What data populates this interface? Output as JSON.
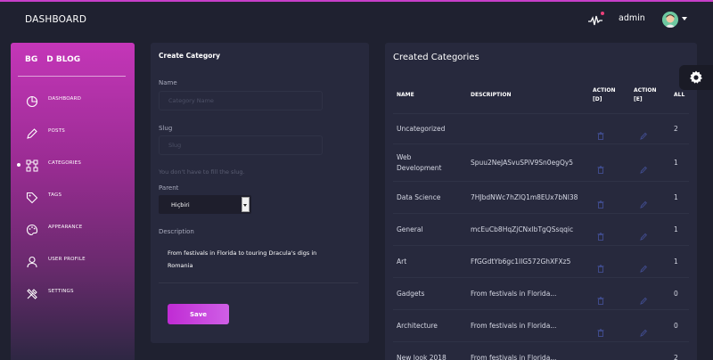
{
  "header": {
    "title": "DASHBOARD",
    "user_name": "admin"
  },
  "sidebar": {
    "brand_left": "BG",
    "brand_right": "D BLOG",
    "items": [
      {
        "label": "DASHBOARD",
        "icon": "dashboard-icon"
      },
      {
        "label": "POSTS",
        "icon": "pencil-icon"
      },
      {
        "label": "CATEGORIES",
        "icon": "hierarchy-icon",
        "active": true
      },
      {
        "label": "TAGS",
        "icon": "tag-icon"
      },
      {
        "label": "APPEARANCE",
        "icon": "palette-icon"
      },
      {
        "label": "USER PROFILE",
        "icon": "user-icon"
      },
      {
        "label": "SETTINGS",
        "icon": "tools-icon"
      }
    ]
  },
  "create": {
    "title": "Create Category",
    "name_label": "Name",
    "name_placeholder": "Category Name",
    "slug_label": "Slug",
    "slug_placeholder": "Slug",
    "slug_hint": "You don't have to fill the slug.",
    "parent_label": "Parent",
    "parent_value": "Hiçbiri",
    "description_label": "Description",
    "description_value": "From festivals in Florida to touring Dracula's digs in Romania",
    "save_label": "Save"
  },
  "list": {
    "title": "Created Categories",
    "columns": {
      "name": "NAME",
      "description": "DESCRIPTION",
      "action_d": "ACTION\n[D]",
      "action_e": "ACTION\n[E]",
      "all": "ALL"
    },
    "rows": [
      {
        "name": "Uncategorized",
        "description": "",
        "count": "2"
      },
      {
        "name": "Web\nDevelopment",
        "description": "Spuu2NeJASvuSPiV9Sn0egQy5",
        "count": "1"
      },
      {
        "name": "Data Science",
        "description": "7HJbdNWc7hZIQ1m8EUx7bNl38",
        "count": "1"
      },
      {
        "name": "General",
        "description": "mcEuCb8HqZjCNxlbTgQSsqqic",
        "count": "1"
      },
      {
        "name": "Art",
        "description": "FfGGdtYb6gc1IlG572GhXFXz5",
        "count": "1"
      },
      {
        "name": "Gadgets",
        "description": "From festivals in Florida...",
        "count": "0"
      },
      {
        "name": "Architecture",
        "description": "From festivals in Florida...",
        "count": "0"
      },
      {
        "name": "New look 2018",
        "description": "From festivals in Florida...",
        "count": "2"
      }
    ]
  },
  "colors": {
    "accent": "#c63ec8",
    "sidebar_top": "#c436b8",
    "background": "#1f2130",
    "card": "#27293d"
  }
}
